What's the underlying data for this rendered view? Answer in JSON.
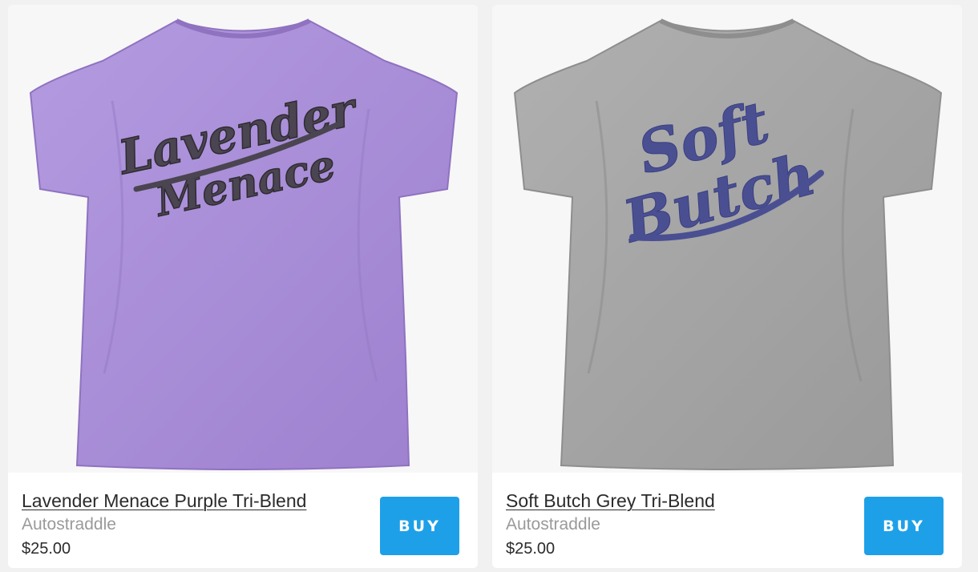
{
  "products": [
    {
      "title": "Lavender Menace Purple Tri-Blend",
      "vendor": "Autostraddle",
      "price": "$25.00",
      "buy_label": "BUY",
      "shirt_color": "#a88cd6",
      "shirt_shadow": "#8f72c0",
      "print_line1": "Lavender",
      "print_line2": "Menace",
      "print_color": "#4a4550",
      "print_outline": "#2f2b33"
    },
    {
      "title": "Soft Butch Grey Tri-Blend",
      "vendor": "Autostraddle",
      "price": "$25.00",
      "buy_label": "BUY",
      "shirt_color": "#a6a6a6",
      "shirt_shadow": "#8e8e8e",
      "print_line1": "Soft",
      "print_line2": "Butch",
      "print_color": "#4a4f92",
      "print_outline": "#3a3f80"
    }
  ]
}
